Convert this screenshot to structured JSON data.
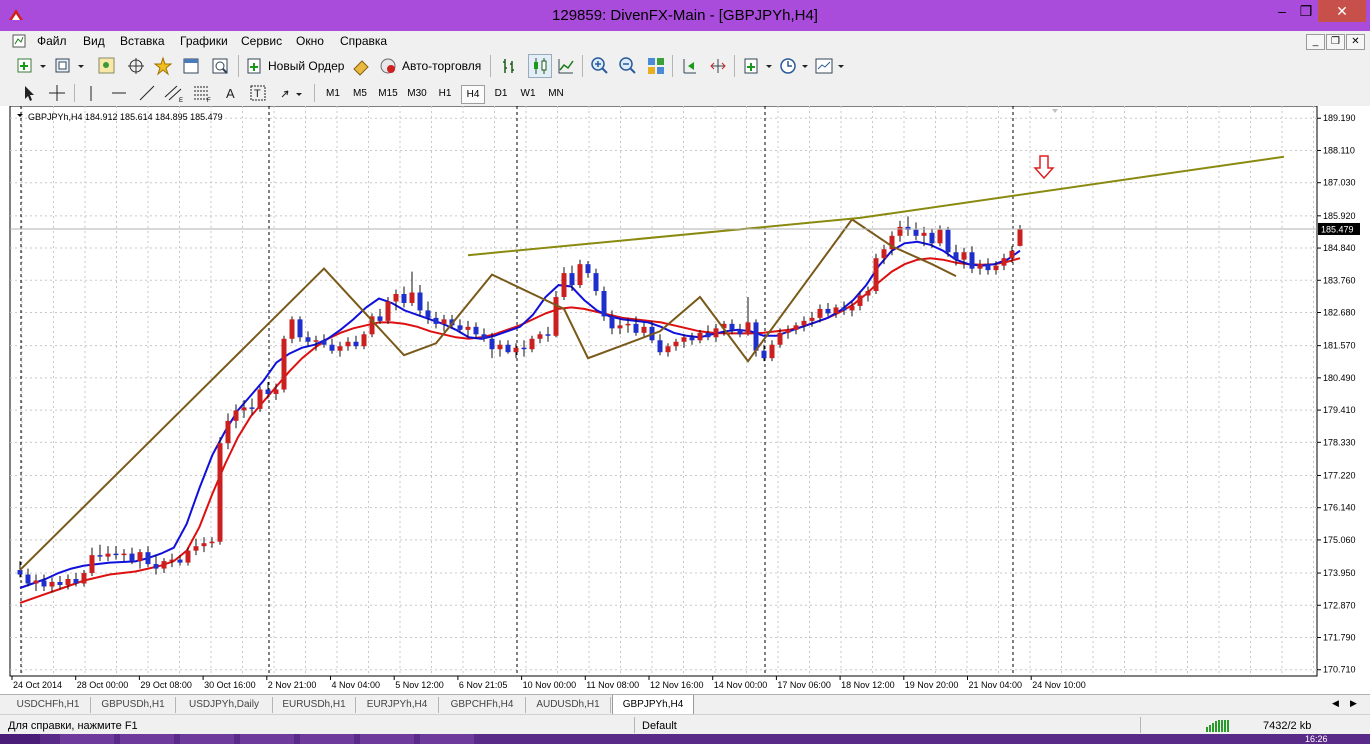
{
  "window": {
    "title": "129859: DivenFX-Main - [GBPJPYh,H4]",
    "minimize": "–",
    "maximize": "❐",
    "close": "✕"
  },
  "menu": [
    "Файл",
    "Вид",
    "Вставка",
    "Графики",
    "Сервис",
    "Окно",
    "Справка"
  ],
  "toolbar": {
    "new_order": "Новый Ордер",
    "autotrading": "Авто-торговля"
  },
  "timeframes": [
    "M1",
    "M5",
    "M15",
    "M30",
    "H1",
    "H4",
    "D1",
    "W1",
    "MN"
  ],
  "active_timeframe": "H4",
  "chart": {
    "info": "GBPJPYh,H4  184.912 185.614 184.895 185.479",
    "current_price": "185.479",
    "price_labels": [
      "189.190",
      "188.110",
      "187.030",
      "185.920",
      "184.840",
      "183.760",
      "182.680",
      "181.570",
      "180.490",
      "179.410",
      "178.330",
      "177.220",
      "176.140",
      "175.060",
      "173.950",
      "172.870",
      "171.790",
      "170.710"
    ],
    "time_labels": [
      "24 Oct 2014",
      "28 Oct 00:00",
      "29 Oct 08:00",
      "30 Oct 16:00",
      "2 Nov 21:00",
      "4 Nov 04:00",
      "5 Nov 12:00",
      "6 Nov 21:05",
      "10 Nov 00:00",
      "11 Nov 08:00",
      "12 Nov 16:00",
      "14 Nov 00:00",
      "17 Nov 06:00",
      "18 Nov 12:00",
      "19 Nov 20:00",
      "21 Nov 04:00",
      "24 Nov 10:00"
    ],
    "colors": {
      "bull": "#cc1f1f",
      "bear": "#1f2fcc",
      "ma_fast": "#1010dd",
      "ma_slow": "#dd1010",
      "zigzag": "#7a5a1a",
      "trendline": "#8a8a10",
      "arrow": "#e02020"
    }
  },
  "chart_data": {
    "type": "candlestick",
    "ylim": [
      170.5,
      189.6
    ],
    "candles": [
      {
        "o": 174.05,
        "h": 174.35,
        "l": 173.8,
        "c": 173.9
      },
      {
        "o": 173.9,
        "h": 174.1,
        "l": 173.5,
        "c": 173.6
      },
      {
        "o": 173.6,
        "h": 173.9,
        "l": 173.35,
        "c": 173.7
      },
      {
        "o": 173.7,
        "h": 173.9,
        "l": 173.35,
        "c": 173.5
      },
      {
        "o": 173.5,
        "h": 173.8,
        "l": 173.3,
        "c": 173.65
      },
      {
        "o": 173.65,
        "h": 173.85,
        "l": 173.4,
        "c": 173.55
      },
      {
        "o": 173.55,
        "h": 173.9,
        "l": 173.4,
        "c": 173.75
      },
      {
        "o": 173.75,
        "h": 173.95,
        "l": 173.5,
        "c": 173.6
      },
      {
        "o": 173.6,
        "h": 174.05,
        "l": 173.5,
        "c": 173.95
      },
      {
        "o": 173.95,
        "h": 174.8,
        "l": 173.85,
        "c": 174.55
      },
      {
        "o": 174.55,
        "h": 174.9,
        "l": 174.35,
        "c": 174.5
      },
      {
        "o": 174.5,
        "h": 174.85,
        "l": 174.35,
        "c": 174.6
      },
      {
        "o": 174.6,
        "h": 174.85,
        "l": 174.4,
        "c": 174.55
      },
      {
        "o": 174.55,
        "h": 174.75,
        "l": 174.35,
        "c": 174.6
      },
      {
        "o": 174.6,
        "h": 174.8,
        "l": 174.25,
        "c": 174.35
      },
      {
        "o": 174.35,
        "h": 174.75,
        "l": 174.1,
        "c": 174.65
      },
      {
        "o": 174.65,
        "h": 174.85,
        "l": 174.15,
        "c": 174.25
      },
      {
        "o": 174.25,
        "h": 174.55,
        "l": 173.9,
        "c": 174.1
      },
      {
        "o": 174.1,
        "h": 174.45,
        "l": 173.95,
        "c": 174.35
      },
      {
        "o": 174.35,
        "h": 174.6,
        "l": 174.15,
        "c": 174.4
      },
      {
        "o": 174.4,
        "h": 174.55,
        "l": 174.2,
        "c": 174.3
      },
      {
        "o": 174.3,
        "h": 174.8,
        "l": 174.2,
        "c": 174.7
      },
      {
        "o": 174.7,
        "h": 175.1,
        "l": 174.55,
        "c": 174.85
      },
      {
        "o": 174.85,
        "h": 175.15,
        "l": 174.65,
        "c": 174.95
      },
      {
        "o": 174.95,
        "h": 175.15,
        "l": 174.8,
        "c": 175.0
      },
      {
        "o": 175.0,
        "h": 178.5,
        "l": 174.9,
        "c": 178.3
      },
      {
        "o": 178.3,
        "h": 179.3,
        "l": 178.1,
        "c": 179.05
      },
      {
        "o": 179.05,
        "h": 179.6,
        "l": 178.8,
        "c": 179.4
      },
      {
        "o": 179.4,
        "h": 179.75,
        "l": 179.15,
        "c": 179.5
      },
      {
        "o": 179.5,
        "h": 179.8,
        "l": 179.25,
        "c": 179.45
      },
      {
        "o": 179.45,
        "h": 180.2,
        "l": 179.35,
        "c": 180.1
      },
      {
        "o": 180.1,
        "h": 180.35,
        "l": 179.8,
        "c": 179.95
      },
      {
        "o": 179.95,
        "h": 180.3,
        "l": 179.75,
        "c": 180.1
      },
      {
        "o": 180.1,
        "h": 181.9,
        "l": 180.0,
        "c": 181.8
      },
      {
        "o": 181.8,
        "h": 182.55,
        "l": 181.65,
        "c": 182.45
      },
      {
        "o": 182.45,
        "h": 182.55,
        "l": 181.7,
        "c": 181.85
      },
      {
        "o": 181.85,
        "h": 182.05,
        "l": 181.55,
        "c": 181.7
      },
      {
        "o": 181.7,
        "h": 181.9,
        "l": 181.4,
        "c": 181.75
      },
      {
        "o": 181.75,
        "h": 181.95,
        "l": 181.5,
        "c": 181.6
      },
      {
        "o": 181.6,
        "h": 181.8,
        "l": 181.3,
        "c": 181.4
      },
      {
        "o": 181.4,
        "h": 181.7,
        "l": 181.2,
        "c": 181.55
      },
      {
        "o": 181.55,
        "h": 181.85,
        "l": 181.4,
        "c": 181.7
      },
      {
        "o": 181.7,
        "h": 181.9,
        "l": 181.45,
        "c": 181.55
      },
      {
        "o": 181.55,
        "h": 182.05,
        "l": 181.45,
        "c": 181.95
      },
      {
        "o": 181.95,
        "h": 182.65,
        "l": 181.85,
        "c": 182.55
      },
      {
        "o": 182.55,
        "h": 182.8,
        "l": 182.3,
        "c": 182.4
      },
      {
        "o": 182.4,
        "h": 183.2,
        "l": 182.3,
        "c": 183.05
      },
      {
        "o": 183.05,
        "h": 183.45,
        "l": 182.75,
        "c": 183.3
      },
      {
        "o": 183.3,
        "h": 183.55,
        "l": 182.85,
        "c": 183.0
      },
      {
        "o": 183.0,
        "h": 184.05,
        "l": 182.9,
        "c": 183.35
      },
      {
        "o": 183.35,
        "h": 183.6,
        "l": 182.55,
        "c": 182.75
      },
      {
        "o": 182.75,
        "h": 183.05,
        "l": 182.3,
        "c": 182.5
      },
      {
        "o": 182.5,
        "h": 182.7,
        "l": 182.15,
        "c": 182.3
      },
      {
        "o": 182.3,
        "h": 182.6,
        "l": 182.05,
        "c": 182.45
      },
      {
        "o": 182.45,
        "h": 182.6,
        "l": 182.15,
        "c": 182.25
      },
      {
        "o": 182.25,
        "h": 182.45,
        "l": 182.0,
        "c": 182.1
      },
      {
        "o": 182.1,
        "h": 182.4,
        "l": 181.85,
        "c": 182.2
      },
      {
        "o": 182.2,
        "h": 182.35,
        "l": 181.8,
        "c": 181.95
      },
      {
        "o": 181.95,
        "h": 182.15,
        "l": 181.7,
        "c": 181.8
      },
      {
        "o": 181.8,
        "h": 182.0,
        "l": 181.15,
        "c": 181.45
      },
      {
        "o": 181.45,
        "h": 181.75,
        "l": 181.2,
        "c": 181.6
      },
      {
        "o": 181.6,
        "h": 181.75,
        "l": 181.3,
        "c": 181.35
      },
      {
        "o": 181.35,
        "h": 181.65,
        "l": 181.15,
        "c": 181.5
      },
      {
        "o": 181.5,
        "h": 181.75,
        "l": 181.2,
        "c": 181.45
      },
      {
        "o": 181.45,
        "h": 181.9,
        "l": 181.35,
        "c": 181.8
      },
      {
        "o": 181.8,
        "h": 182.05,
        "l": 181.65,
        "c": 181.95
      },
      {
        "o": 181.95,
        "h": 182.2,
        "l": 181.7,
        "c": 181.9
      },
      {
        "o": 181.9,
        "h": 183.4,
        "l": 181.85,
        "c": 183.2
      },
      {
        "o": 183.2,
        "h": 184.2,
        "l": 183.1,
        "c": 184.0
      },
      {
        "o": 184.0,
        "h": 184.25,
        "l": 183.4,
        "c": 183.6
      },
      {
        "o": 183.6,
        "h": 184.45,
        "l": 183.5,
        "c": 184.3
      },
      {
        "o": 184.3,
        "h": 184.4,
        "l": 183.85,
        "c": 184.0
      },
      {
        "o": 184.0,
        "h": 184.15,
        "l": 183.25,
        "c": 183.4
      },
      {
        "o": 183.4,
        "h": 183.55,
        "l": 182.4,
        "c": 182.55
      },
      {
        "o": 182.55,
        "h": 182.75,
        "l": 181.95,
        "c": 182.15
      },
      {
        "o": 182.15,
        "h": 182.45,
        "l": 181.95,
        "c": 182.25
      },
      {
        "o": 182.25,
        "h": 182.5,
        "l": 182.0,
        "c": 182.3
      },
      {
        "o": 182.3,
        "h": 182.55,
        "l": 181.9,
        "c": 182.0
      },
      {
        "o": 182.0,
        "h": 182.35,
        "l": 181.85,
        "c": 182.2
      },
      {
        "o": 182.2,
        "h": 182.4,
        "l": 181.65,
        "c": 181.75
      },
      {
        "o": 181.75,
        "h": 181.95,
        "l": 181.25,
        "c": 181.35
      },
      {
        "o": 181.35,
        "h": 181.65,
        "l": 181.2,
        "c": 181.55
      },
      {
        "o": 181.55,
        "h": 181.8,
        "l": 181.4,
        "c": 181.7
      },
      {
        "o": 181.7,
        "h": 181.95,
        "l": 181.5,
        "c": 181.85
      },
      {
        "o": 181.85,
        "h": 182.0,
        "l": 181.6,
        "c": 181.75
      },
      {
        "o": 181.75,
        "h": 182.1,
        "l": 181.65,
        "c": 182.0
      },
      {
        "o": 182.0,
        "h": 182.25,
        "l": 181.75,
        "c": 181.85
      },
      {
        "o": 181.85,
        "h": 182.3,
        "l": 181.7,
        "c": 182.15
      },
      {
        "o": 182.15,
        "h": 182.4,
        "l": 181.9,
        "c": 182.3
      },
      {
        "o": 182.3,
        "h": 182.45,
        "l": 181.95,
        "c": 182.1
      },
      {
        "o": 182.1,
        "h": 182.3,
        "l": 181.85,
        "c": 181.95
      },
      {
        "o": 181.95,
        "h": 183.2,
        "l": 181.9,
        "c": 182.35
      },
      {
        "o": 182.35,
        "h": 182.45,
        "l": 181.2,
        "c": 181.4
      },
      {
        "o": 181.4,
        "h": 181.6,
        "l": 181.05,
        "c": 181.15
      },
      {
        "o": 181.15,
        "h": 181.75,
        "l": 181.05,
        "c": 181.6
      },
      {
        "o": 181.6,
        "h": 182.15,
        "l": 181.5,
        "c": 182.0
      },
      {
        "o": 182.0,
        "h": 182.25,
        "l": 181.8,
        "c": 182.1
      },
      {
        "o": 182.1,
        "h": 182.35,
        "l": 181.95,
        "c": 182.25
      },
      {
        "o": 182.25,
        "h": 182.55,
        "l": 182.05,
        "c": 182.4
      },
      {
        "o": 182.4,
        "h": 182.7,
        "l": 182.2,
        "c": 182.5
      },
      {
        "o": 182.5,
        "h": 182.95,
        "l": 182.35,
        "c": 182.8
      },
      {
        "o": 182.8,
        "h": 183.0,
        "l": 182.55,
        "c": 182.65
      },
      {
        "o": 182.65,
        "h": 182.95,
        "l": 182.5,
        "c": 182.85
      },
      {
        "o": 182.85,
        "h": 183.05,
        "l": 182.6,
        "c": 182.75
      },
      {
        "o": 182.75,
        "h": 183.05,
        "l": 182.55,
        "c": 182.9
      },
      {
        "o": 182.9,
        "h": 183.4,
        "l": 182.75,
        "c": 183.25
      },
      {
        "o": 183.25,
        "h": 183.55,
        "l": 183.05,
        "c": 183.4
      },
      {
        "o": 183.4,
        "h": 184.65,
        "l": 183.3,
        "c": 184.5
      },
      {
        "o": 184.5,
        "h": 184.95,
        "l": 184.3,
        "c": 184.8
      },
      {
        "o": 184.8,
        "h": 185.4,
        "l": 184.6,
        "c": 185.25
      },
      {
        "o": 185.25,
        "h": 185.75,
        "l": 185.05,
        "c": 185.55
      },
      {
        "o": 185.55,
        "h": 185.9,
        "l": 185.25,
        "c": 185.45
      },
      {
        "o": 185.45,
        "h": 185.7,
        "l": 185.1,
        "c": 185.25
      },
      {
        "o": 185.25,
        "h": 185.55,
        "l": 184.9,
        "c": 185.35
      },
      {
        "o": 185.35,
        "h": 185.5,
        "l": 184.85,
        "c": 185.0
      },
      {
        "o": 185.0,
        "h": 185.6,
        "l": 184.9,
        "c": 185.45
      },
      {
        "o": 185.45,
        "h": 185.55,
        "l": 184.55,
        "c": 184.7
      },
      {
        "o": 184.7,
        "h": 184.95,
        "l": 184.25,
        "c": 184.45
      },
      {
        "o": 184.45,
        "h": 184.85,
        "l": 184.15,
        "c": 184.7
      },
      {
        "o": 184.7,
        "h": 184.9,
        "l": 184.0,
        "c": 184.15
      },
      {
        "o": 184.15,
        "h": 184.45,
        "l": 183.95,
        "c": 184.3
      },
      {
        "o": 184.3,
        "h": 184.5,
        "l": 183.95,
        "c": 184.1
      },
      {
        "o": 184.1,
        "h": 184.4,
        "l": 183.95,
        "c": 184.25
      },
      {
        "o": 184.25,
        "h": 184.65,
        "l": 184.1,
        "c": 184.5
      },
      {
        "o": 184.5,
        "h": 184.9,
        "l": 184.35,
        "c": 184.75
      },
      {
        "o": 184.912,
        "h": 185.614,
        "l": 184.895,
        "c": 185.479
      }
    ],
    "ma_fast": [
      173.45,
      173.6,
      173.75,
      173.95,
      174.1,
      174.2,
      174.25,
      174.3,
      174.32,
      174.34,
      174.45,
      174.6,
      174.8,
      175.6,
      176.8,
      177.9,
      178.7,
      179.4,
      179.9,
      180.4,
      181.0,
      181.3,
      181.5,
      181.6,
      181.8,
      182.1,
      182.45,
      182.85,
      183.15,
      183.0,
      182.75,
      182.6,
      182.45,
      182.3,
      182.1,
      181.85,
      181.8,
      181.9,
      182.05,
      182.2,
      182.6,
      183.2,
      183.6,
      183.55,
      183.1,
      182.75,
      182.55,
      182.45,
      182.4,
      182.35,
      182.2,
      182.0,
      181.9,
      181.85,
      181.95,
      182.05,
      182.1,
      182.05,
      181.9,
      181.9,
      182.05,
      182.2,
      182.35,
      182.5,
      182.75,
      183.1,
      183.6,
      184.25,
      184.75,
      185.0,
      185.05,
      184.95,
      184.75,
      184.45,
      184.3,
      184.25,
      184.3,
      184.45,
      184.75
    ],
    "ma_slow": [
      172.95,
      173.1,
      173.25,
      173.4,
      173.55,
      173.7,
      173.8,
      173.9,
      173.95,
      174.0,
      174.1,
      174.2,
      174.35,
      174.7,
      175.5,
      176.6,
      177.6,
      178.5,
      179.2,
      179.7,
      180.2,
      180.7,
      181.15,
      181.5,
      181.8,
      182.0,
      182.15,
      182.25,
      182.35,
      182.35,
      182.3,
      182.2,
      182.05,
      181.95,
      181.85,
      181.8,
      181.85,
      181.95,
      182.1,
      182.25,
      182.45,
      182.65,
      182.8,
      182.85,
      182.8,
      182.7,
      182.6,
      182.5,
      182.45,
      182.4,
      182.35,
      182.25,
      182.15,
      182.05,
      182.0,
      181.98,
      181.98,
      181.98,
      182.0,
      182.05,
      182.1,
      182.2,
      182.35,
      182.5,
      182.7,
      182.95,
      183.3,
      183.7,
      184.05,
      184.3,
      184.45,
      184.5,
      184.45,
      184.35,
      184.3,
      184.28,
      184.3,
      184.38,
      184.5
    ],
    "zigzag": [
      [
        0,
        174.05
      ],
      [
        38,
        184.15
      ],
      [
        48,
        181.25
      ],
      [
        52,
        181.65
      ],
      [
        59,
        183.95
      ],
      [
        68,
        182.8
      ],
      [
        71,
        181.15
      ],
      [
        80,
        182.05
      ],
      [
        85,
        183.2
      ],
      [
        91,
        181.05
      ],
      [
        104,
        185.8
      ],
      [
        109,
        184.9
      ],
      [
        114,
        184.3
      ],
      [
        117,
        183.9
      ]
    ],
    "trendline": [
      [
        56,
        184.6
      ],
      [
        105,
        185.85
      ],
      [
        158,
        187.9
      ]
    ]
  },
  "tabs": [
    "USDCHFh,H1",
    "GBPUSDh,H1",
    "USDJPYh,Daily",
    "EURUSDh,H1",
    "EURJPYh,H4",
    "GBPCHFh,H4",
    "AUDUSDh,H1",
    "GBPJPYh,H4"
  ],
  "active_tab": "GBPJPYh,H4",
  "status": {
    "help": "Для справки, нажмите F1",
    "profile": "Default",
    "traffic": "7432/2 kb"
  },
  "taskbar": {
    "time": "16:26"
  }
}
